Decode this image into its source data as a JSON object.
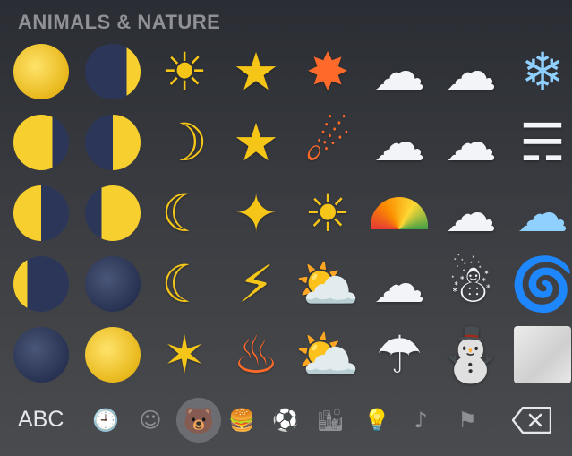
{
  "section": {
    "title": "ANIMALS & NATURE"
  },
  "emoji_grid": [
    [
      {
        "icon": "full-moon",
        "glyph": "",
        "style": "moon-full"
      },
      {
        "icon": "waxing-crescent-moon",
        "glyph": "",
        "style": "moon-crescent-r"
      },
      {
        "icon": "sun-with-face",
        "glyph": "☀",
        "style": "glyph"
      },
      {
        "icon": "star",
        "glyph": "★",
        "style": "glyph"
      },
      {
        "icon": "collision",
        "glyph": "✸",
        "style": "glyph glyph-red"
      },
      {
        "icon": "sun-behind-cloud",
        "glyph": "☁",
        "style": "glyph-white"
      },
      {
        "icon": "cloud-with-lightning-and-rain",
        "glyph": "☁",
        "style": "glyph-white"
      },
      {
        "icon": "snowflake",
        "glyph": "❄",
        "style": "glyph-blue"
      }
    ],
    [
      {
        "icon": "waning-gibbous-moon",
        "glyph": "",
        "style": "moon-gibbous-r"
      },
      {
        "icon": "first-quarter-moon",
        "glyph": "",
        "style": "moon-half-r"
      },
      {
        "icon": "crescent-moon-face",
        "glyph": "☽",
        "style": "glyph"
      },
      {
        "icon": "glowing-star",
        "glyph": "★",
        "style": "glyph"
      },
      {
        "icon": "comet",
        "glyph": "☄",
        "style": "glyph glyph-red"
      },
      {
        "icon": "sun-behind-rain-cloud",
        "glyph": "☁",
        "style": "glyph-white"
      },
      {
        "icon": "cloud-with-lightning",
        "glyph": "☁",
        "style": "glyph-white"
      },
      {
        "icon": "wind-face",
        "glyph": "☴",
        "style": "glyph-white"
      }
    ],
    [
      {
        "icon": "last-quarter-moon",
        "glyph": "",
        "style": "moon-half-l"
      },
      {
        "icon": "waxing-gibbous-moon",
        "glyph": "",
        "style": "moon-gibbous-l"
      },
      {
        "icon": "last-quarter-moon-face",
        "glyph": "☾",
        "style": "glyph"
      },
      {
        "icon": "sparkles",
        "glyph": "✦",
        "style": "glyph"
      },
      {
        "icon": "sun",
        "glyph": "☀",
        "style": "glyph"
      },
      {
        "icon": "rainbow",
        "glyph": "",
        "style": "glyph-rainbow"
      },
      {
        "icon": "cloud-with-snow",
        "glyph": "☁",
        "style": "glyph-white"
      },
      {
        "icon": "dashing-away",
        "glyph": "☁",
        "style": "glyph-blue"
      }
    ],
    [
      {
        "icon": "waning-crescent-moon",
        "glyph": "",
        "style": "moon-crescent-l"
      },
      {
        "icon": "new-moon-face",
        "glyph": "",
        "style": "moon-new"
      },
      {
        "icon": "crescent-moon",
        "glyph": "☾",
        "style": "glyph"
      },
      {
        "icon": "high-voltage",
        "glyph": "⚡",
        "style": "glyph"
      },
      {
        "icon": "sun-behind-small-cloud",
        "glyph": "⛅",
        "style": "glyph"
      },
      {
        "icon": "cloud",
        "glyph": "☁",
        "style": "glyph-white"
      },
      {
        "icon": "snowman",
        "glyph": "☃",
        "style": "glyph-white"
      },
      {
        "icon": "tornado",
        "glyph": "🌀",
        "style": "glyph-gray"
      }
    ],
    [
      {
        "icon": "new-moon",
        "glyph": "",
        "style": "moon-new"
      },
      {
        "icon": "full-moon-face",
        "glyph": "",
        "style": "moon-full"
      },
      {
        "icon": "dizzy",
        "glyph": "✶",
        "style": "glyph"
      },
      {
        "icon": "fire",
        "glyph": "♨",
        "style": "glyph glyph-red"
      },
      {
        "icon": "sun-behind-large-cloud",
        "glyph": "⛅",
        "style": "glyph"
      },
      {
        "icon": "cloud-with-rain",
        "glyph": "☂",
        "style": "glyph-white"
      },
      {
        "icon": "snowman-without-snow",
        "glyph": "⛄",
        "style": "glyph-white"
      },
      {
        "icon": "fog",
        "glyph": "",
        "style": "fog-square"
      }
    ]
  ],
  "bottom_bar": {
    "abc_label": "ABC",
    "categories": [
      {
        "icon": "clock-icon",
        "glyph": "🕘",
        "active": false
      },
      {
        "icon": "smiley-icon",
        "glyph": "☺",
        "active": false
      },
      {
        "icon": "bear-icon",
        "glyph": "🐻",
        "active": true
      },
      {
        "icon": "food-icon",
        "glyph": "🍔",
        "active": false
      },
      {
        "icon": "soccer-ball-icon",
        "glyph": "⚽",
        "active": false
      },
      {
        "icon": "buildings-car-icon",
        "glyph": "🏙",
        "active": false
      },
      {
        "icon": "lightbulb-icon",
        "glyph": "💡",
        "active": false
      },
      {
        "icon": "symbols-icon",
        "glyph": "♪",
        "active": false
      },
      {
        "icon": "flag-icon",
        "glyph": "⚑",
        "active": false
      }
    ]
  },
  "colors": {
    "background_top": "#2a2d33",
    "background_bottom": "#4a4b4e",
    "section_title": "#8f9196",
    "active_category_bg": "#6b6d72"
  }
}
